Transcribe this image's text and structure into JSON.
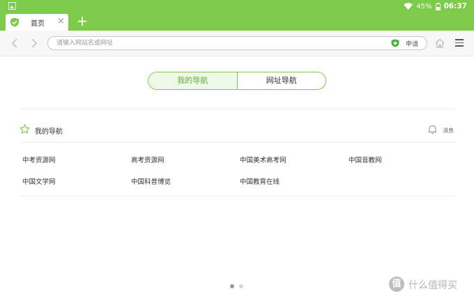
{
  "status_bar": {
    "icons": [
      "gallery-icon",
      "wifi-icon",
      "battery-icon"
    ],
    "battery": "45%",
    "time": "06:37"
  },
  "tab_bar": {
    "tabs": [
      {
        "title": "首页",
        "close_glyph": "×"
      }
    ],
    "add_glyph": "+"
  },
  "address_bar": {
    "placeholder": "请输入网站名或网址",
    "value": "",
    "apply_label": "申请"
  },
  "segmented": {
    "items": [
      {
        "label": "我的导航",
        "active": true
      },
      {
        "label": "网址导航",
        "active": false
      }
    ]
  },
  "section": {
    "title": "我的导航",
    "message_label": "消息"
  },
  "links": [
    "中考资源网",
    "高考资源网",
    "中国美术高考网",
    "中国音教网",
    "中国文学网",
    "中国科普博览",
    "中国教育在线"
  ],
  "pager": {
    "count": 2,
    "active": 1
  },
  "watermark": {
    "badge": "值",
    "text": "什么值得买"
  },
  "colors": {
    "brand_green": "#7ccb4a",
    "active_text": "#5db036",
    "active_bg": "#eff8e8"
  }
}
